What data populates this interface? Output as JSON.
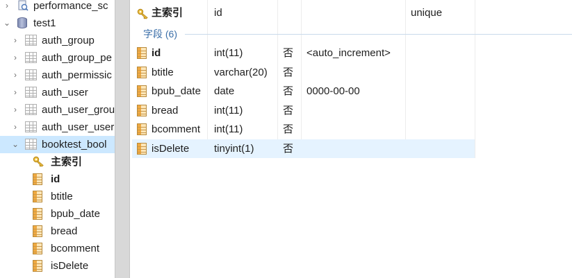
{
  "tree": {
    "items": [
      {
        "label": "performance_sc",
        "icon": "schema-icon",
        "arrow": "›",
        "indent": 0,
        "type": "perf"
      },
      {
        "label": "test1",
        "icon": "database-icon",
        "arrow": "⌄",
        "indent": 0,
        "type": "db"
      },
      {
        "label": "auth_group",
        "icon": "table-icon",
        "arrow": "›",
        "indent": 1,
        "type": "table"
      },
      {
        "label": "auth_group_pe",
        "icon": "table-icon",
        "arrow": "›",
        "indent": 1,
        "type": "table"
      },
      {
        "label": "auth_permissic",
        "icon": "table-icon",
        "arrow": "›",
        "indent": 1,
        "type": "table"
      },
      {
        "label": "auth_user",
        "icon": "table-icon",
        "arrow": "›",
        "indent": 1,
        "type": "table"
      },
      {
        "label": "auth_user_grou",
        "icon": "table-icon",
        "arrow": "›",
        "indent": 1,
        "type": "table"
      },
      {
        "label": "auth_user_user",
        "icon": "table-icon",
        "arrow": "›",
        "indent": 1,
        "type": "table"
      },
      {
        "label": "booktest_bool",
        "icon": "table-icon",
        "arrow": "⌄",
        "indent": 1,
        "type": "table",
        "selected": true
      },
      {
        "label": "主索引",
        "icon": "key-icon",
        "arrow": "",
        "indent": 2,
        "type": "key",
        "bold": true
      },
      {
        "label": "id",
        "icon": "column-icon",
        "arrow": "",
        "indent": 2,
        "type": "col",
        "bold": true
      },
      {
        "label": "btitle",
        "icon": "column-icon",
        "arrow": "",
        "indent": 2,
        "type": "col"
      },
      {
        "label": "bpub_date",
        "icon": "column-icon",
        "arrow": "",
        "indent": 2,
        "type": "col"
      },
      {
        "label": "bread",
        "icon": "column-icon",
        "arrow": "",
        "indent": 2,
        "type": "col"
      },
      {
        "label": "bcomment",
        "icon": "column-icon",
        "arrow": "",
        "indent": 2,
        "type": "col"
      },
      {
        "label": "isDelete",
        "icon": "column-icon",
        "arrow": "",
        "indent": 2,
        "type": "col"
      }
    ]
  },
  "grid": {
    "index_row": {
      "name": "主索引",
      "column": "id",
      "kind": "unique",
      "icon": "key-icon"
    },
    "section_label": "字段 (6)",
    "fields": [
      {
        "name": "id",
        "type": "int(11)",
        "nullable": "否",
        "default": "<auto_increment>",
        "bold": true
      },
      {
        "name": "btitle",
        "type": "varchar(20)",
        "nullable": "否",
        "default": ""
      },
      {
        "name": "bpub_date",
        "type": "date",
        "nullable": "否",
        "default": "0000-00-00"
      },
      {
        "name": "bread",
        "type": "int(11)",
        "nullable": "否",
        "default": ""
      },
      {
        "name": "bcomment",
        "type": "int(11)",
        "nullable": "否",
        "default": ""
      },
      {
        "name": "isDelete",
        "type": "tinyint(1)",
        "nullable": "否",
        "default": "",
        "selected": true
      }
    ]
  },
  "colors": {
    "selection": "#cce8ff",
    "row_selection": "#e5f3ff",
    "section_text": "#3a6ea8"
  }
}
